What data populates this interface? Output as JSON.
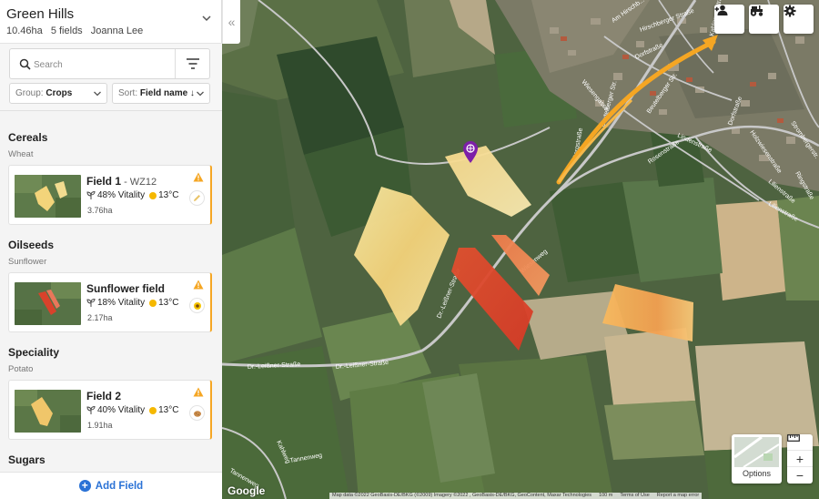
{
  "farm": {
    "name": "Green Hills",
    "area": "10.46ha",
    "fields_count": "5 fields",
    "owner": "Joanna Lee"
  },
  "search": {
    "placeholder": "Search",
    "value": ""
  },
  "group": {
    "label": "Group:",
    "value": "Crops"
  },
  "sort": {
    "label": "Sort:",
    "value": "Field name ↓"
  },
  "sections": [
    {
      "title": "Cereals",
      "subtitle": "Wheat",
      "fields": [
        {
          "name": "Field 1",
          "crop_code": " - WZ12",
          "vitality": "48% Vitality",
          "temperature": "13°C",
          "area": "3.76ha",
          "thumb_color": "#f3d47a",
          "crop_icon": "pencil-icon"
        }
      ]
    },
    {
      "title": "Oilseeds",
      "subtitle": "Sunflower",
      "fields": [
        {
          "name": "Sunflower field",
          "crop_code": "",
          "vitality": "18% Vitality",
          "temperature": "13°C",
          "area": "2.17ha",
          "thumb_color": "#d9422b",
          "crop_icon": "sunflower-icon"
        }
      ]
    },
    {
      "title": "Speciality",
      "subtitle": "Potato",
      "fields": [
        {
          "name": "Field 2",
          "crop_code": "",
          "vitality": "40% Vitality",
          "temperature": "13°C",
          "area": "1.91ha",
          "thumb_color": "#f0c66a",
          "crop_icon": "potato-icon"
        }
      ]
    },
    {
      "title": "Sugars",
      "subtitle": "",
      "fields": []
    }
  ],
  "add_field_label": "Add Field",
  "map": {
    "streets": [
      "Dr.-Leißner-Straße",
      "Dr.-Leißner-Straße",
      "Dr.-Leißner-Straße",
      "Dorfstraße",
      "Dorfstraße",
      "Bergstraße",
      "Kahlgrundstraße",
      "Am Hirschb...",
      "Hirschberger Straße",
      "Wiesengasse",
      "Beutelberger Str.",
      "Beutelberger Str.",
      "Lindenstraße",
      "Holzwiesenstraße",
      "Lilienstraße",
      "Tannenweg",
      "Kahlweg",
      "Tannenweg",
      "Lilienstraße",
      "Wiesenweg",
      "Rosenstraße",
      "Strombergerstr.",
      "Ringstraße"
    ],
    "options_label": "Options",
    "google_label": "Google",
    "attribution": [
      "Map data ©2022 GeoBasis-DE/BKG (©2009) Imagery ©2022 , GeoBasis-DE/BKG, GeoContent, Maxar Technologies",
      "100 m",
      "Terms of Use",
      "Report a map error"
    ],
    "accent_color": "#f5a623"
  }
}
